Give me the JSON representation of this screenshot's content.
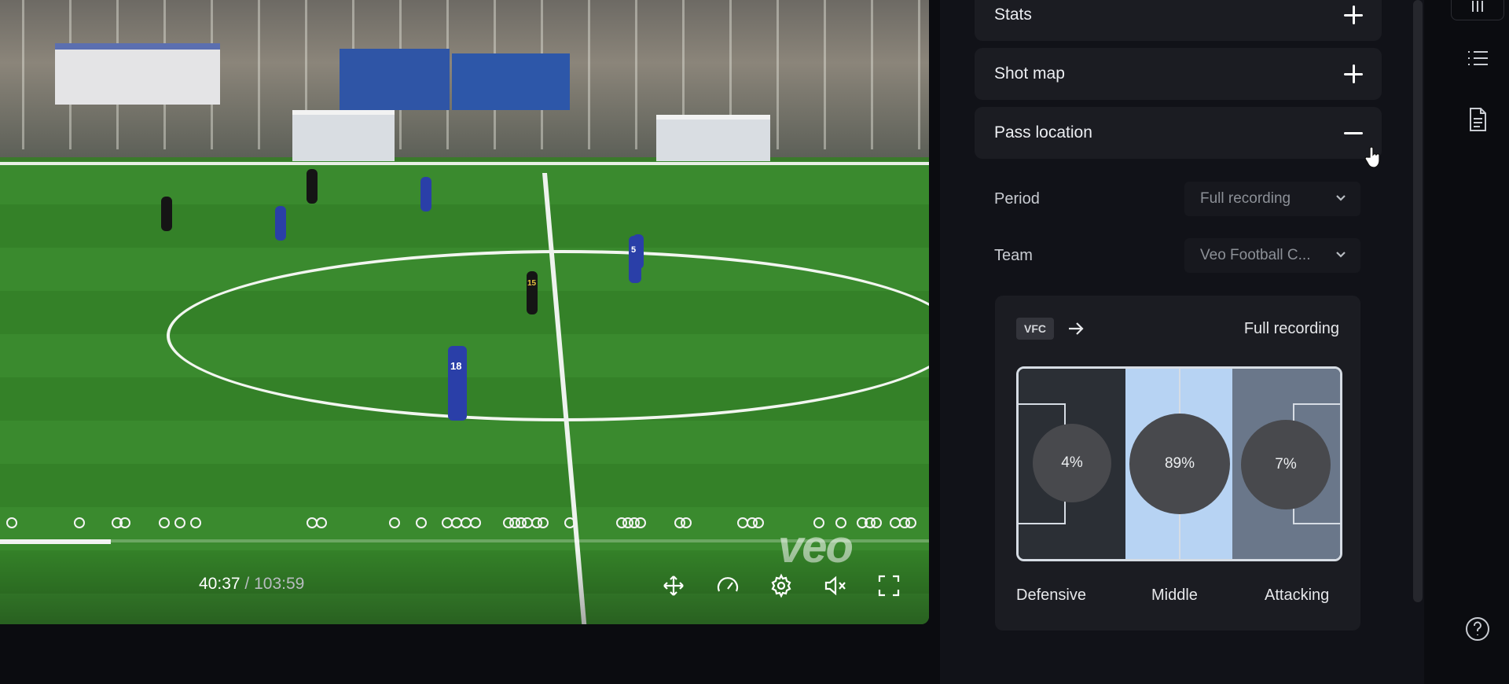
{
  "video": {
    "current_time": "40:37",
    "separator": "/",
    "duration": "103:59",
    "progress_fraction": 0.119,
    "watermark": "veo",
    "jersey_numbers": [
      "18",
      "15",
      "5"
    ]
  },
  "panel": {
    "sections": {
      "stats": {
        "label": "Stats"
      },
      "shot_map": {
        "label": "Shot map"
      },
      "pass_location": {
        "label": "Pass location"
      }
    },
    "filters": {
      "period_label": "Period",
      "period_value": "Full recording",
      "team_label": "Team",
      "team_value": "Veo Football C..."
    },
    "pass_card": {
      "team_badge": "VFC",
      "period": "Full recording",
      "zones": [
        {
          "label": "Defensive",
          "percent": "4%"
        },
        {
          "label": "Middle",
          "percent": "89%"
        },
        {
          "label": "Attacking",
          "percent": "7%"
        }
      ]
    }
  },
  "colors": {
    "middle_zone": "#b7d3f3",
    "attacking_zone": "#6a778a",
    "defensive_zone": "#2b2f35",
    "panel_bg": "#111218"
  },
  "icons": [
    "expand-arrows-icon",
    "speed-gauge-icon",
    "gear-icon",
    "mute-icon",
    "fullscreen-icon",
    "arrow-right-icon",
    "list-icon",
    "document-icon",
    "help-icon",
    "chevron-down-icon"
  ]
}
